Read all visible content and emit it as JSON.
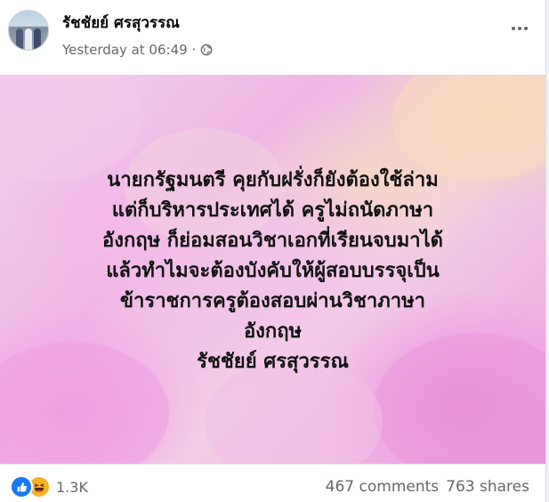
{
  "post": {
    "author": "รัชชัยย์ ศรสุวรรณ",
    "timestamp": "Yesterday at 06:49",
    "separator": "·",
    "privacy_icon": "globe-icon",
    "more_icon": "more-options-icon",
    "background_colors": [
      "#f5d3ee",
      "#efb6e6",
      "#f8d8b0",
      "#ec92df"
    ],
    "text": "นายกรัฐมนตรี คุยกับฝรั่งก็ยังต้องใช้ล่าม\nแต่ก็บริหารประเทศได้ ครูไม่ถนัดภาษา\nอังกฤษ ก็ย่อมสอนวิชาเอกที่เรียนจบมาได้\nแล้วทำไมจะต้องบังคับให้ผู้สอบบรรจุเป็น\nข้าราชการครูต้องสอบผ่านวิชาภาษา\nอังกฤษ\nรัชชัยย์ ศรสุวรรณ"
  },
  "footer": {
    "reaction_icons": [
      "like-icon",
      "haha-icon"
    ],
    "reaction_count": "1.3K",
    "comments": "467 comments",
    "shares": "763 shares",
    "like_color": "#1877f2",
    "haha_color": "#f7b125"
  }
}
